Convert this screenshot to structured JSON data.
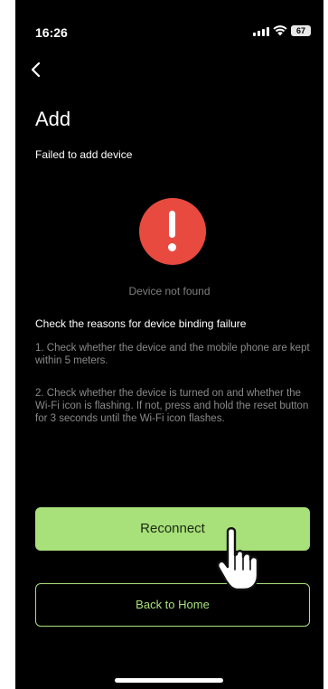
{
  "status_bar": {
    "time": "16:26",
    "battery": "67",
    "icons": [
      "signal-icon",
      "wifi-icon",
      "battery-icon"
    ]
  },
  "header": {
    "back_icon": "chevron-left-icon",
    "title": "Add",
    "subtitle": "Failed to add device"
  },
  "alert": {
    "icon": "exclamation-icon",
    "color": "#e84a3f",
    "message": "Device not found"
  },
  "reasons": {
    "title": "Check the reasons for device binding failure",
    "items": [
      "1. Check whether the device and the mobile phone are kept within 5 meters.",
      "2. Check whether the device is turned on and whether the Wi-Fi icon is flashing. If not, press and hold the reset button for 3 seconds until the Wi-Fi icon flashes."
    ]
  },
  "actions": {
    "reconnect_label": "Reconnect",
    "back_home_label": "Back to Home",
    "accent": "#a8e07a"
  },
  "pointer_icon": "hand-pointer-icon"
}
